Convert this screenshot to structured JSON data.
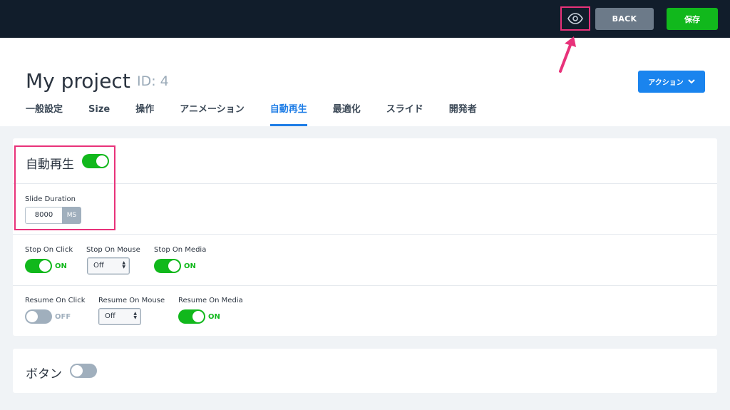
{
  "topbar": {
    "preview_icon": "eye-icon",
    "back_label": "BACK",
    "save_label": "保存"
  },
  "header": {
    "project_title": "My project",
    "project_id": "ID: 4",
    "action_label": "アクション",
    "action_icon": "chevron-down-icon"
  },
  "tabs": [
    {
      "label": "一般設定",
      "active": false
    },
    {
      "label": "Size",
      "active": false
    },
    {
      "label": "操作",
      "active": false
    },
    {
      "label": "アニメーション",
      "active": false
    },
    {
      "label": "自動再生",
      "active": true
    },
    {
      "label": "最適化",
      "active": false
    },
    {
      "label": "スライド",
      "active": false
    },
    {
      "label": "開発者",
      "active": false
    }
  ],
  "autoplay": {
    "title": "自動再生",
    "enabled": true,
    "slide_duration_label": "Slide Duration",
    "slide_duration_value": "8000",
    "slide_duration_unit": "MS",
    "stop_on_click_label": "Stop On Click",
    "stop_on_click_state": "ON",
    "stop_on_mouse_label": "Stop On Mouse",
    "stop_on_mouse_value": "Off",
    "stop_on_media_label": "Stop On Media",
    "stop_on_media_state": "ON",
    "resume_on_click_label": "Resume On Click",
    "resume_on_click_state": "OFF",
    "resume_on_mouse_label": "Resume On Mouse",
    "resume_on_mouse_value": "Off",
    "resume_on_media_label": "Resume On Media",
    "resume_on_media_state": "ON"
  },
  "buttons_section": {
    "title": "ボタン",
    "enabled": false
  },
  "colors": {
    "topbar": "#111d2b",
    "accent_green": "#11b81c",
    "accent_blue": "#1a84ee",
    "annotation_pink": "#e8327a"
  }
}
